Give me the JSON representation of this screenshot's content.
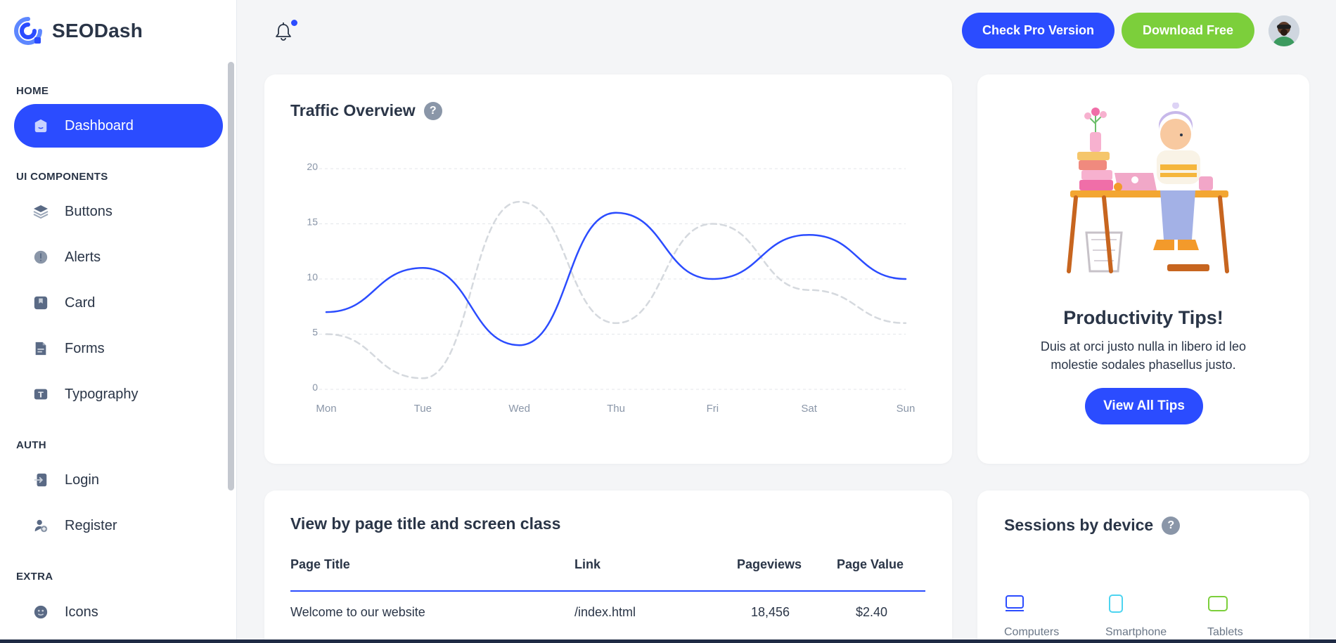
{
  "brand": {
    "name": "SEODash"
  },
  "sidebar": {
    "sections": [
      {
        "title": "HOME"
      },
      {
        "title": "UI COMPONENTS"
      },
      {
        "title": "AUTH"
      },
      {
        "title": "EXTRA"
      }
    ],
    "items": [
      {
        "label": "Dashboard",
        "icon": "home-icon"
      },
      {
        "label": "Buttons",
        "icon": "layers-icon"
      },
      {
        "label": "Alerts",
        "icon": "alert-icon"
      },
      {
        "label": "Card",
        "icon": "bookmark-icon"
      },
      {
        "label": "Forms",
        "icon": "file-text-icon"
      },
      {
        "label": "Typography",
        "icon": "typography-icon"
      },
      {
        "label": "Login",
        "icon": "login-icon"
      },
      {
        "label": "Register",
        "icon": "user-plus-icon"
      },
      {
        "label": "Icons",
        "icon": "mood-icon"
      }
    ]
  },
  "header": {
    "pro_label": "Check Pro Version",
    "download_label": "Download Free"
  },
  "traffic": {
    "title": "Traffic Overview",
    "help": "?"
  },
  "chart_data": {
    "type": "line",
    "title": "Traffic Overview",
    "categories": [
      "Mon",
      "Tue",
      "Wed",
      "Thu",
      "Fri",
      "Sat",
      "Sun"
    ],
    "ylim": [
      0,
      20
    ],
    "yticks": [
      0,
      5,
      10,
      15,
      20
    ],
    "grid": true,
    "series": [
      {
        "values": [
          7,
          11,
          4,
          16,
          10,
          14,
          10
        ],
        "color": "#2b4cff",
        "style": "solid"
      },
      {
        "values": [
          5,
          1,
          17,
          6,
          15,
          9,
          6
        ],
        "color": "#d5d9de",
        "style": "dashed"
      }
    ]
  },
  "tips": {
    "title": "Productivity Tips!",
    "text": "Duis at orci justo nulla in libero id leo molestie sodales phasellus justo.",
    "button": "View All Tips"
  },
  "table": {
    "title": "View by page title and screen class",
    "headers": [
      "Page Title",
      "Link",
      "Pageviews",
      "Page Value"
    ],
    "rows": [
      [
        "Welcome to our website",
        "/index.html",
        "18,456",
        "$2.40"
      ]
    ]
  },
  "sessions": {
    "title": "Sessions by device",
    "help": "?",
    "devices": [
      {
        "label": "Computers",
        "color": "#2b4cff"
      },
      {
        "label": "Smartphone",
        "color": "#4dd4f0"
      },
      {
        "label": "Tablets",
        "color": "#7ccf3b"
      }
    ]
  }
}
